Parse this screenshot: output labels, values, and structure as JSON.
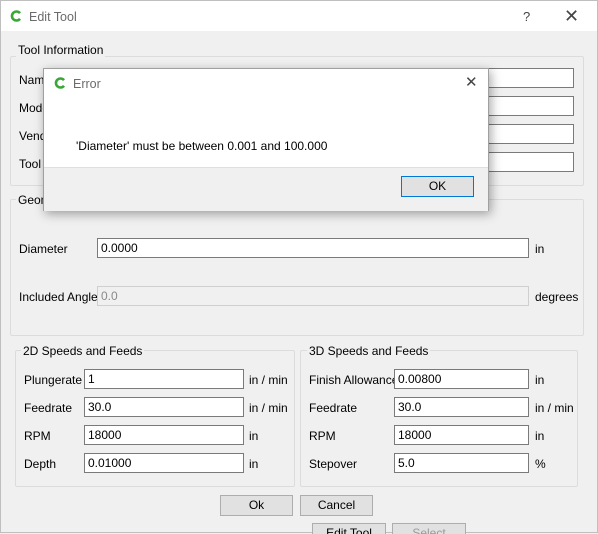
{
  "window": {
    "title": "Edit Tool",
    "help_label": "?",
    "close_label": "✕"
  },
  "tool_info": {
    "legend": "Tool Information",
    "name_label": "Name",
    "model_label": "Mode",
    "vendor_label": "Vend",
    "tool_label": "Tool N",
    "name_value": "",
    "model_value": "",
    "vendor_value": "",
    "tool_value": ""
  },
  "geometry": {
    "legend": "Geom",
    "diameter_label": "Diameter",
    "diameter_value": "0.0000",
    "diameter_unit": "in",
    "angle_label": "Included Angle",
    "angle_value": "0.0",
    "angle_unit": "degrees"
  },
  "speeds_2d": {
    "legend": "2D Speeds and Feeds",
    "fields": [
      {
        "label": "Plungerate",
        "value": "1",
        "unit": "in / min"
      },
      {
        "label": "Feedrate",
        "value": "30.0",
        "unit": "in / min"
      },
      {
        "label": "RPM",
        "value": "18000",
        "unit": "in"
      },
      {
        "label": "Depth",
        "value": "0.01000",
        "unit": "in"
      }
    ]
  },
  "speeds_3d": {
    "legend": "3D Speeds and Feeds",
    "fields": [
      {
        "label": "Finish Allowance",
        "value": "0.00800",
        "unit": "in"
      },
      {
        "label": "Feedrate",
        "value": "30.0",
        "unit": "in / min"
      },
      {
        "label": "RPM",
        "value": "18000",
        "unit": "in"
      },
      {
        "label": "Stepover",
        "value": "5.0",
        "unit": "%"
      }
    ]
  },
  "buttons": {
    "ok": "Ok",
    "cancel": "Cancel",
    "behind_edit_tool": "Edit Tool",
    "behind_select": "Select"
  },
  "error_dialog": {
    "title": "Error",
    "message": "'Diameter' must be between 0.001 and 100.000",
    "ok": "OK",
    "close_label": "✕"
  },
  "colors": {
    "accent": "#0078d7",
    "app_icon_green": "#3aa635"
  }
}
